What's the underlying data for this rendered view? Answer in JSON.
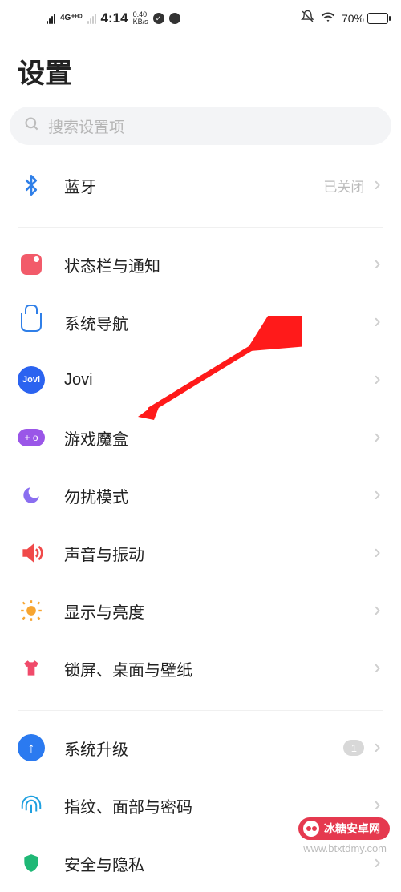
{
  "status": {
    "network": "4G⁺ᴴᴰ",
    "time": "4:14",
    "speed_val": "0.40",
    "speed_unit": "KB/s",
    "battery_pct": "70%"
  },
  "title": "设置",
  "search": {
    "placeholder": "搜索设置项"
  },
  "items": {
    "bluetooth": {
      "label": "蓝牙",
      "value": "已关闭"
    },
    "notif": {
      "label": "状态栏与通知"
    },
    "nav": {
      "label": "系统导航"
    },
    "jovi": {
      "label": "Jovi",
      "icon_text": "Jovi"
    },
    "gamebox": {
      "label": "游戏魔盒",
      "icon_text": "+ o"
    },
    "dnd": {
      "label": "勿扰模式"
    },
    "sound": {
      "label": "声音与振动"
    },
    "bright": {
      "label": "显示与亮度"
    },
    "lock": {
      "label": "锁屏、桌面与壁纸"
    },
    "upgrade": {
      "label": "系统升级",
      "badge": "1"
    },
    "fingerprint": {
      "label": "指纹、面部与密码"
    },
    "security": {
      "label": "安全与隐私"
    }
  },
  "watermark": {
    "text": "冰糖安卓网",
    "url": "www.btxtdmy.com"
  }
}
